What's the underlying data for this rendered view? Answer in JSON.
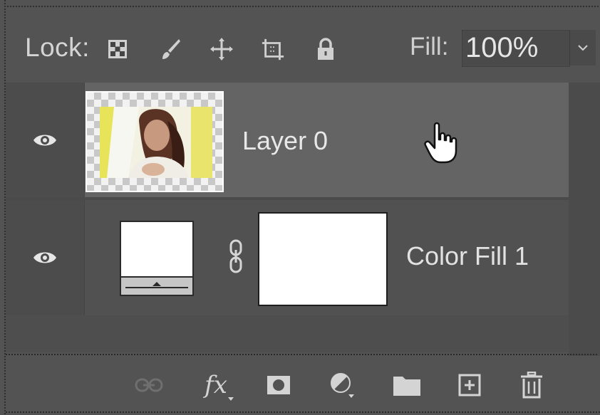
{
  "lock_bar": {
    "lock_label": "Lock:",
    "icons": [
      "lock-transparent-pixels-icon",
      "lock-image-pixels-icon",
      "lock-position-icon",
      "lock-artboard-icon",
      "lock-all-icon"
    ],
    "fill_label": "Fill:",
    "fill_value": "100%"
  },
  "layers": [
    {
      "name": "Layer 0",
      "visible": true,
      "selected": true
    },
    {
      "name": "Color Fill 1",
      "visible": true,
      "selected": false
    }
  ],
  "bottom_toolbar": {
    "icons": [
      "link-layers-icon",
      "fx-icon",
      "add-mask-icon",
      "adjustment-layer-icon",
      "new-group-icon",
      "new-layer-icon",
      "delete-icon"
    ],
    "fx_label": "fx"
  },
  "colors": {
    "panel_bg": "#535353",
    "selected_row": "#646464",
    "text": "#e6e6e6"
  }
}
